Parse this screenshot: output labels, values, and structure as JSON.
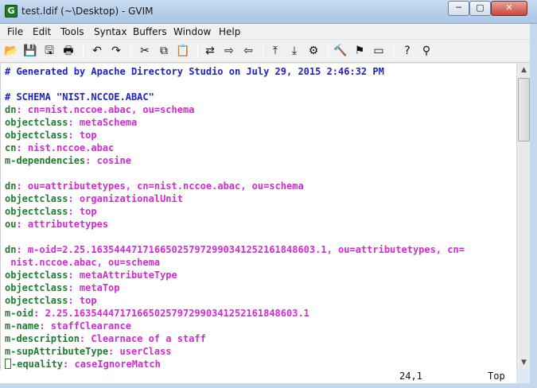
{
  "window": {
    "title": "test.ldif (~\\Desktop) - GVIM",
    "app_icon_glyph": "G",
    "min_glyph": "─",
    "max_glyph": "▢",
    "close_glyph": "✕"
  },
  "menu": [
    "File",
    "Edit",
    "Tools",
    "Syntax",
    "Buffers",
    "Window",
    "Help"
  ],
  "toolbar": [
    {
      "name": "open-icon",
      "glyph": "📂"
    },
    {
      "name": "save-icon",
      "glyph": "💾"
    },
    {
      "name": "save-all-icon",
      "glyph": "🖫"
    },
    {
      "name": "print-icon",
      "glyph": "🖶"
    },
    {
      "name": "undo-icon",
      "glyph": "↶"
    },
    {
      "name": "redo-icon",
      "glyph": "↷"
    },
    {
      "name": "cut-icon",
      "glyph": "✂"
    },
    {
      "name": "copy-icon",
      "glyph": "⧉"
    },
    {
      "name": "paste-icon",
      "glyph": "📋"
    },
    {
      "name": "replace-icon",
      "glyph": "⇄"
    },
    {
      "name": "find-next-icon",
      "glyph": "⇨"
    },
    {
      "name": "find-prev-icon",
      "glyph": "⇦"
    },
    {
      "name": "load-session-icon",
      "glyph": "⤒"
    },
    {
      "name": "save-session-icon",
      "glyph": "⤓"
    },
    {
      "name": "run-script-icon",
      "glyph": "⚙"
    },
    {
      "name": "make-icon",
      "glyph": "🔨"
    },
    {
      "name": "tags-icon",
      "glyph": "⚑"
    },
    {
      "name": "jump-tag-icon",
      "glyph": "▭"
    },
    {
      "name": "help-icon",
      "glyph": "?"
    },
    {
      "name": "find-help-icon",
      "glyph": "⚲"
    }
  ],
  "lines": [
    [
      {
        "c": "cmt",
        "t": "# Generated by Apache Directory Studio on July 29, 2015 2:46:32 PM"
      }
    ],
    [],
    [
      {
        "c": "cmt",
        "t": "# SCHEMA \"NIST.NCCOE.ABAC\""
      }
    ],
    [
      {
        "c": "k",
        "t": "dn"
      },
      {
        "c": "v",
        "t": ": cn=nist.nccoe.abac, ou=schema"
      }
    ],
    [
      {
        "c": "k",
        "t": "objectclass"
      },
      {
        "c": "v",
        "t": ": metaSchema"
      }
    ],
    [
      {
        "c": "k",
        "t": "objectclass"
      },
      {
        "c": "v",
        "t": ": top"
      }
    ],
    [
      {
        "c": "k",
        "t": "cn"
      },
      {
        "c": "v",
        "t": ": nist.nccoe.abac"
      }
    ],
    [
      {
        "c": "k",
        "t": "m-dependencies"
      },
      {
        "c": "v",
        "t": ": cosine"
      }
    ],
    [],
    [
      {
        "c": "k",
        "t": "dn"
      },
      {
        "c": "v",
        "t": ": ou=attributetypes, cn=nist.nccoe.abac, ou=schema"
      }
    ],
    [
      {
        "c": "k",
        "t": "objectclass"
      },
      {
        "c": "v",
        "t": ": organizationalUnit"
      }
    ],
    [
      {
        "c": "k",
        "t": "objectclass"
      },
      {
        "c": "v",
        "t": ": top"
      }
    ],
    [
      {
        "c": "k",
        "t": "ou"
      },
      {
        "c": "v",
        "t": ": attributetypes"
      }
    ],
    [],
    [
      {
        "c": "k",
        "t": "dn"
      },
      {
        "c": "v",
        "t": ": m-oid=2.25.163544471716650257972990341252161848603.1, ou=attributetypes, cn="
      }
    ],
    [
      {
        "c": "v",
        "t": " nist.nccoe.abac, ou=schema"
      }
    ],
    [
      {
        "c": "k",
        "t": "objectclass"
      },
      {
        "c": "v",
        "t": ": metaAttributeType"
      }
    ],
    [
      {
        "c": "k",
        "t": "objectclass"
      },
      {
        "c": "v",
        "t": ": metaTop"
      }
    ],
    [
      {
        "c": "k",
        "t": "objectclass"
      },
      {
        "c": "v",
        "t": ": top"
      }
    ],
    [
      {
        "c": "k",
        "t": "m-oid"
      },
      {
        "c": "v",
        "t": ": 2.25.163544471716650257972990341252161848603.1"
      }
    ],
    [
      {
        "c": "k",
        "t": "m-name"
      },
      {
        "c": "v",
        "t": ": staffClearance"
      }
    ],
    [
      {
        "c": "k",
        "t": "m-description"
      },
      {
        "c": "v",
        "t": ": Clearnace of a staff"
      }
    ],
    [
      {
        "c": "k",
        "t": "m-supAttributeType"
      },
      {
        "c": "v",
        "t": ": userClass"
      }
    ],
    [
      {
        "c": "cursor",
        "t": ""
      },
      {
        "c": "k",
        "t": "-equality"
      },
      {
        "c": "v",
        "t": ": caseIgnoreMatch"
      }
    ]
  ],
  "status": {
    "position": "24,1",
    "scroll": "Top"
  },
  "scroll_position_fraction": 0.0,
  "colors": {
    "keyword": "#1f7d2b",
    "value": "#d42ad4",
    "comment": "#1d23c9"
  }
}
